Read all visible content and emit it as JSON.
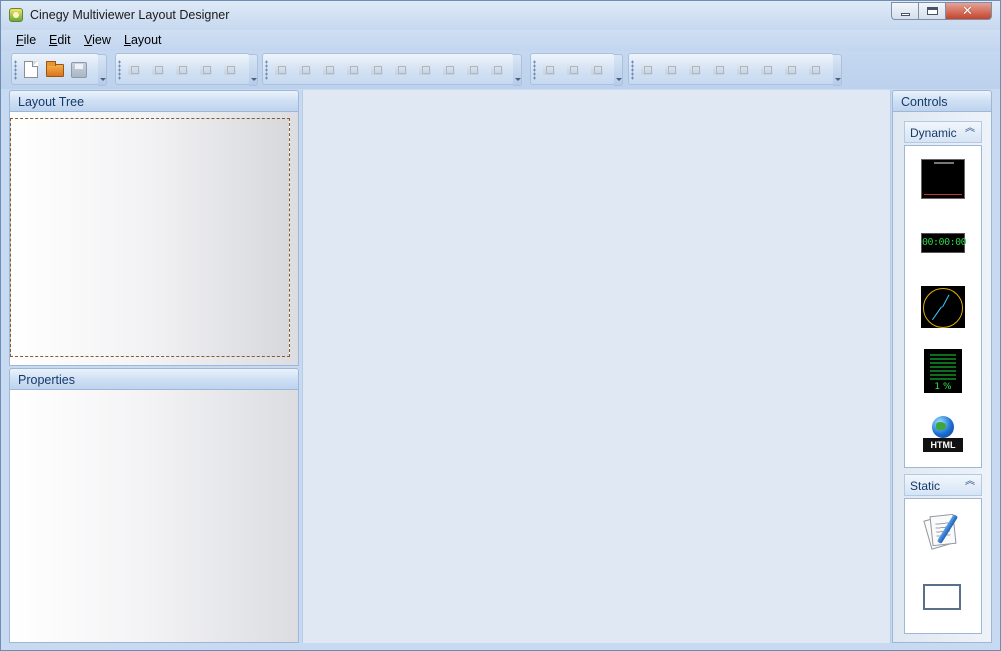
{
  "window": {
    "title": "Cinegy Multiviewer Layout Designer"
  },
  "menu": {
    "file": "File",
    "edit": "Edit",
    "view": "View",
    "layout": "Layout"
  },
  "panels": {
    "layout_tree": "Layout Tree",
    "properties": "Properties",
    "controls": "Controls"
  },
  "controls": {
    "dynamic": {
      "header": "Dynamic",
      "items": [
        {
          "icon": "waveform-monitor-icon"
        },
        {
          "icon": "timecode-icon",
          "display": "00:00:00"
        },
        {
          "icon": "analog-clock-icon"
        },
        {
          "icon": "audio-meter-icon",
          "display": "1 %"
        },
        {
          "icon": "html-globe-icon",
          "display": "HTML"
        }
      ]
    },
    "static": {
      "header": "Static",
      "items": [
        {
          "icon": "text-note-icon"
        },
        {
          "icon": "rectangle-icon"
        }
      ]
    }
  }
}
